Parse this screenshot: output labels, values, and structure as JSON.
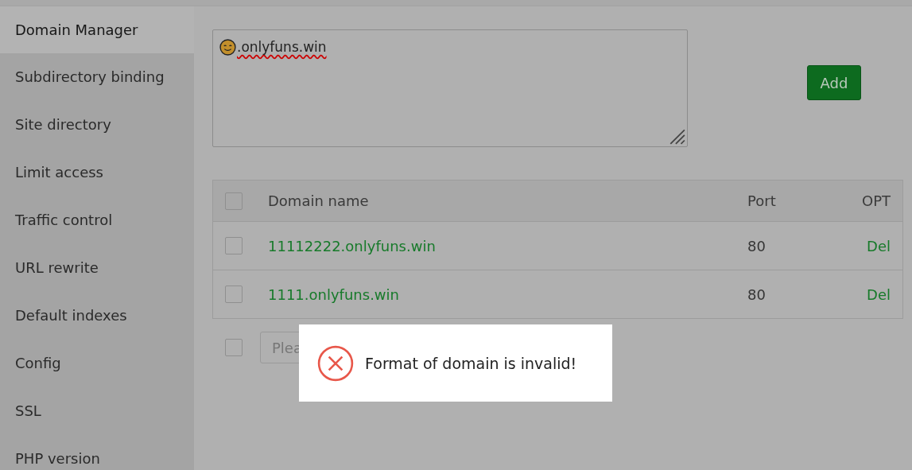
{
  "sidebar": {
    "items": [
      {
        "label": "Domain Manager",
        "selected": true
      },
      {
        "label": "Subdirectory binding",
        "selected": false
      },
      {
        "label": "Site directory",
        "selected": false
      },
      {
        "label": "Limit access",
        "selected": false
      },
      {
        "label": "Traffic control",
        "selected": false
      },
      {
        "label": "URL rewrite",
        "selected": false
      },
      {
        "label": "Default indexes",
        "selected": false
      },
      {
        "label": "Config",
        "selected": false
      },
      {
        "label": "SSL",
        "selected": false
      },
      {
        "label": "PHP version",
        "selected": false
      }
    ]
  },
  "domain_input": {
    "value": ".onlyfuns.win"
  },
  "add_button": "Add",
  "table": {
    "all_checked": false,
    "columns": [
      "Domain name",
      "Port",
      "OPT"
    ],
    "rows": [
      {
        "checked": false,
        "domain": "11112222.onlyfuns.win",
        "port": "80",
        "action": "Del"
      },
      {
        "checked": false,
        "domain": "1111.onlyfuns.win",
        "port": "80",
        "action": "Del"
      }
    ]
  },
  "batch": {
    "checked": false,
    "placeholder": "Plea"
  },
  "toast": {
    "kind": "error",
    "message": "Format of domain is invalid!"
  }
}
